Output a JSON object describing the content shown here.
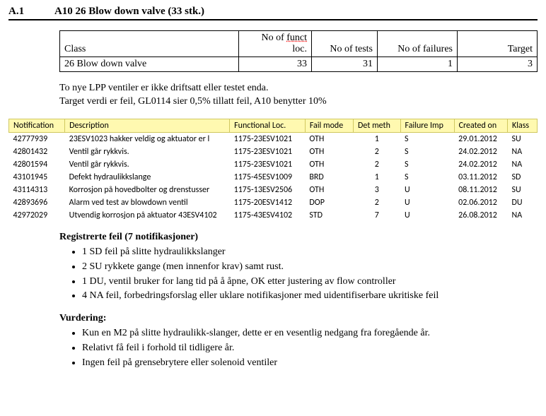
{
  "heading": {
    "section": "A.1",
    "title": "A10 26 Blow down valve (33 stk.)"
  },
  "summary_table": {
    "headers": {
      "class": "Class",
      "funct_loc_1": "No of ",
      "funct_loc_2": "funct",
      "funct_loc_3": "loc.",
      "tests": "No of tests",
      "failures": "No of failures",
      "target": "Target"
    },
    "row": {
      "class": "26 Blow down valve",
      "funct_loc": "33",
      "tests": "31",
      "failures": "1",
      "target": "3"
    }
  },
  "note1": "To nye LPP ventiler er ikke driftsatt eller testet enda.",
  "note2": "Target verdi er feil, GL0114 sier 0,5% tillatt feil, A10 benytter 10%",
  "data_table": {
    "headers": {
      "notification": "Notification",
      "description": "Description",
      "funcloc": "Functional Loc.",
      "failmode": "Fail mode",
      "detmeth": "Det meth",
      "failureimp": "Failure Imp",
      "created": "Created on",
      "klass": "Klass"
    },
    "rows": [
      {
        "notification": "42777939",
        "description": "23ESV1023 hakker veldig og aktuator er l",
        "funcloc": "1175-23ESV1021",
        "failmode": "OTH",
        "detmeth": "1",
        "failureimp": "S",
        "created": "29.01.2012",
        "klass": "SU"
      },
      {
        "notification": "42801432",
        "description": "Ventil går rykkvis.",
        "funcloc": "1175-23ESV1021",
        "failmode": "OTH",
        "detmeth": "2",
        "failureimp": "S",
        "created": "24.02.2012",
        "klass": "NA"
      },
      {
        "notification": "42801594",
        "description": "Ventil går rykkvis.",
        "funcloc": "1175-23ESV1021",
        "failmode": "OTH",
        "detmeth": "2",
        "failureimp": "S",
        "created": "24.02.2012",
        "klass": "NA"
      },
      {
        "notification": "43101945",
        "description": "Defekt hydraulikkslange",
        "funcloc": "1175-45ESV1009",
        "failmode": "BRD",
        "detmeth": "1",
        "failureimp": "S",
        "created": "03.11.2012",
        "klass": "SD"
      },
      {
        "notification": "43114313",
        "description": "Korrosjon på hovedbolter og drenstusser",
        "funcloc": "1175-13ESV2506",
        "failmode": "OTH",
        "detmeth": "3",
        "failureimp": "U",
        "created": "08.11.2012",
        "klass": "SU"
      },
      {
        "notification": "42893696",
        "description": "Alarm ved test av blowdown ventil",
        "funcloc": "1175-20ESV1412",
        "failmode": "DOP",
        "detmeth": "2",
        "failureimp": "U",
        "created": "02.06.2012",
        "klass": "DU"
      },
      {
        "notification": "42972029",
        "description": "Utvendig korrosjon på aktuator 43ESV4102",
        "funcloc": "1175-43ESV4102",
        "failmode": "STD",
        "detmeth": "7",
        "failureimp": "U",
        "created": "26.08.2012",
        "klass": "NA"
      }
    ]
  },
  "section_reg": {
    "title": "Registrerte feil (7 notifikasjoner)",
    "items": [
      "1 SD feil på slitte hydraulikkslanger",
      "2 SU rykkete gange (men innenfor krav) samt rust.",
      "1 DU, ventil bruker for lang tid på å åpne,  OK etter justering av flow controller",
      "4 NA feil, forbedringsforslag eller uklare notifikasjoner med uidentifiserbare ukritiske feil"
    ]
  },
  "section_vurd": {
    "title": "Vurdering:",
    "items": [
      "Kun en M2 på slitte hydraulikk-slanger, dette er en vesentlig nedgang fra foregående år.",
      "Relativt få feil i forhold til tidligere år.",
      "Ingen feil på grensebrytere eller solenoid ventiler"
    ]
  }
}
